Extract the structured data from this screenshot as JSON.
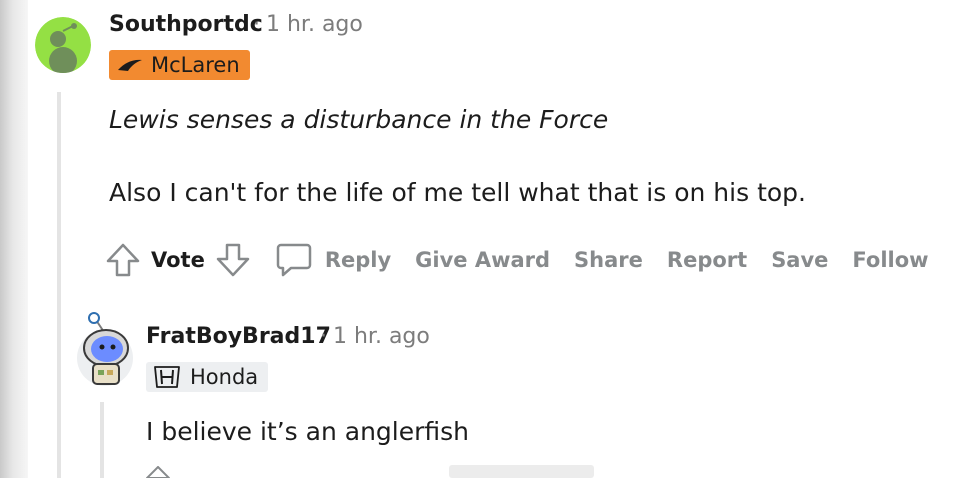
{
  "comment1": {
    "username": "Southportdc",
    "timestamp": "1 hr. ago",
    "flair": {
      "text": "McLaren",
      "bg": "#f28a30",
      "color": "#1c1c1c",
      "icon": "mclaren-swoosh-icon"
    },
    "line1": "Lewis senses a disturbance in the Force",
    "line2": "Also I can't for the life of me tell what that is on his top.",
    "actions": {
      "vote": "Vote",
      "reply": "Reply",
      "give_award": "Give Award",
      "share": "Share",
      "report": "Report",
      "save": "Save",
      "follow": "Follow"
    }
  },
  "comment2": {
    "username": "FratBoyBrad17",
    "timestamp": "1 hr. ago",
    "flair": {
      "text": "Honda",
      "bg": "#edeff1",
      "color": "#1c1c1c",
      "icon": "honda-logo-icon"
    },
    "text": "I believe it’s an anglerfish"
  },
  "colors": {
    "meta": "#7c7c7c",
    "action": "#878a8c",
    "thread_line": "#e4e4e4"
  }
}
